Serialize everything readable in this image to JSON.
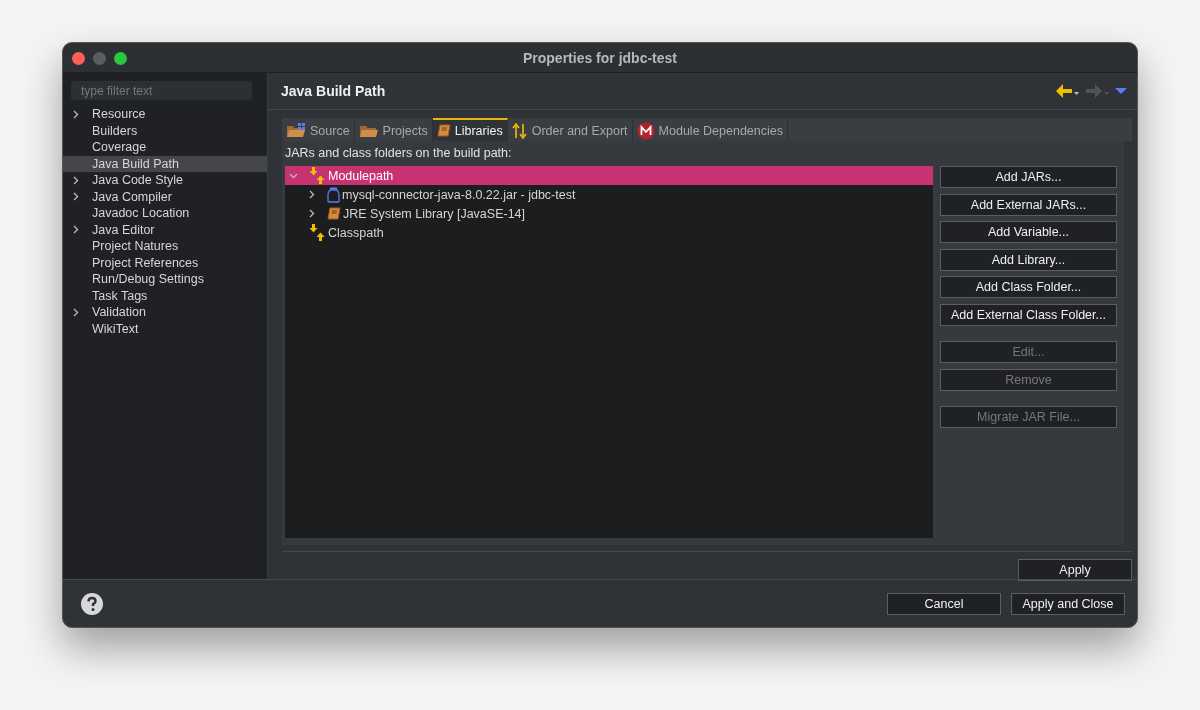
{
  "window": {
    "title": "Properties for jdbc-test"
  },
  "filter": {
    "placeholder": "type filter text"
  },
  "sidebar": {
    "items": [
      {
        "label": "Resource",
        "expandable": true,
        "selected": false
      },
      {
        "label": "Builders",
        "expandable": false,
        "selected": false
      },
      {
        "label": "Coverage",
        "expandable": false,
        "selected": false
      },
      {
        "label": "Java Build Path",
        "expandable": false,
        "selected": true
      },
      {
        "label": "Java Code Style",
        "expandable": true,
        "selected": false
      },
      {
        "label": "Java Compiler",
        "expandable": true,
        "selected": false
      },
      {
        "label": "Javadoc Location",
        "expandable": false,
        "selected": false
      },
      {
        "label": "Java Editor",
        "expandable": true,
        "selected": false
      },
      {
        "label": "Project Natures",
        "expandable": false,
        "selected": false
      },
      {
        "label": "Project References",
        "expandable": false,
        "selected": false
      },
      {
        "label": "Run/Debug Settings",
        "expandable": false,
        "selected": false
      },
      {
        "label": "Task Tags",
        "expandable": false,
        "selected": false
      },
      {
        "label": "Validation",
        "expandable": true,
        "selected": false
      },
      {
        "label": "WikiText",
        "expandable": false,
        "selected": false
      }
    ]
  },
  "page": {
    "title": "Java Build Path"
  },
  "tabs": [
    {
      "label": "Source",
      "kind": "source",
      "selected": false
    },
    {
      "label": "Projects",
      "kind": "folder",
      "selected": false
    },
    {
      "label": "Libraries",
      "kind": "library",
      "selected": true
    },
    {
      "label": "Order and Export",
      "kind": "order",
      "selected": false
    },
    {
      "label": "Module Dependencies",
      "kind": "module",
      "selected": false
    }
  ],
  "tree_label": "JARs and class folders on the build path:",
  "tree": [
    {
      "label": "Modulepath",
      "kind": "container",
      "expandable": true,
      "expanded": true,
      "selected": true,
      "children": [
        {
          "label": "mysql-connector-java-8.0.22.jar - jdbc-test",
          "kind": "jar",
          "expandable": true,
          "expanded": false,
          "selected": false
        },
        {
          "label": "JRE System Library [JavaSE-14]",
          "kind": "library",
          "expandable": true,
          "expanded": false,
          "selected": false
        }
      ]
    },
    {
      "label": "Classpath",
      "kind": "container",
      "expandable": false,
      "selected": false
    }
  ],
  "button_groups": [
    [
      {
        "label": "Add JARs...",
        "disabled": false
      },
      {
        "label": "Add External JARs...",
        "disabled": false
      },
      {
        "label": "Add Variable...",
        "disabled": false
      },
      {
        "label": "Add Library...",
        "disabled": false
      },
      {
        "label": "Add Class Folder...",
        "disabled": false
      },
      {
        "label": "Add External Class Folder...",
        "disabled": false
      }
    ],
    [
      {
        "label": "Edit...",
        "disabled": true
      },
      {
        "label": "Remove",
        "disabled": true
      }
    ],
    [
      {
        "label": "Migrate JAR File...",
        "disabled": true
      }
    ]
  ],
  "apply_button": "Apply",
  "footer_buttons": [
    "Cancel",
    "Apply and Close"
  ]
}
